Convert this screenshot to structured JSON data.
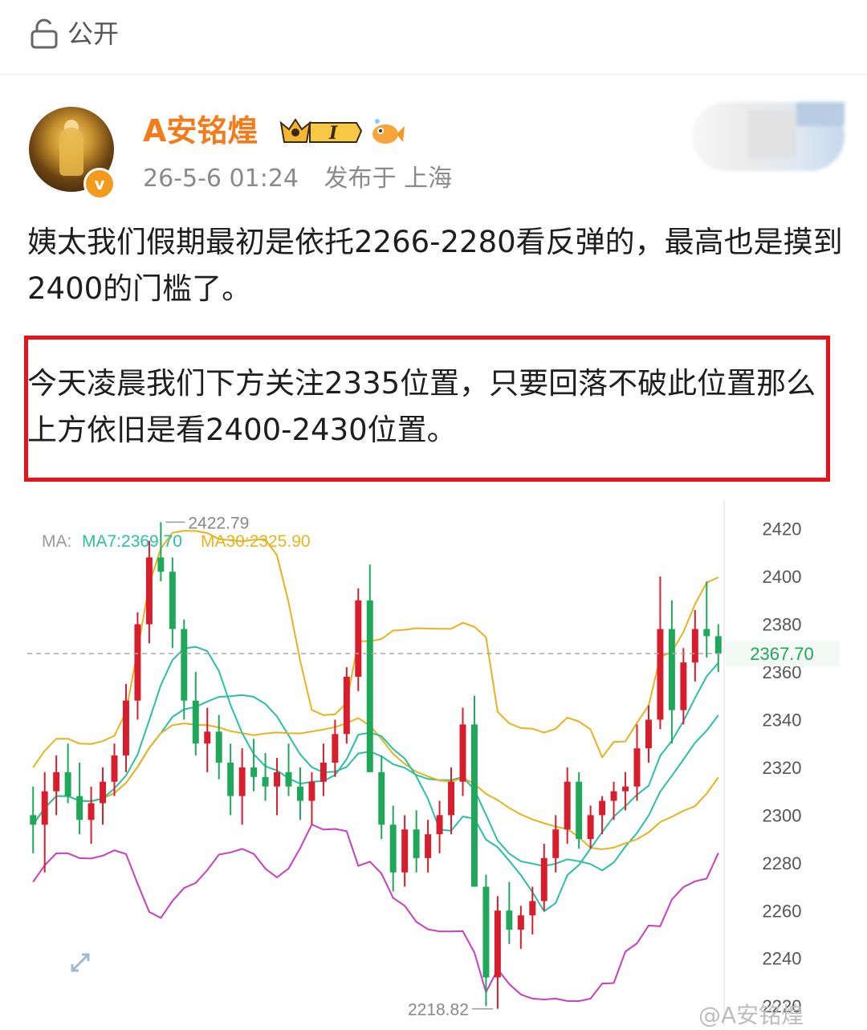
{
  "visibility": {
    "label": "公开",
    "icon": "lock-icon"
  },
  "post": {
    "author": "A安铭煌",
    "level_badge": "I",
    "date": "26-5-6 01:24",
    "location": "发布于 上海",
    "paragraph1": "姨太我们假期最初是依托2266-2280看反弹的，最高也是摸到2400的门槛了。",
    "paragraph2": "今天凌晨我们下方关注2335位置，只要回落不破此位置那么上方依旧是看2400-2430位置。",
    "watermark": "@A安铭煌"
  },
  "colors": {
    "username": "#f27b1c",
    "highlight_border": "#e8121b",
    "candle_up": "#d81e2c",
    "candle_down": "#1fa85a",
    "ma7": "#2bbfa4",
    "ma30": "#e8b21f",
    "boll_upper": "#e8b21f",
    "boll_mid": "#2bbfa4",
    "boll_lower": "#c93fbf"
  },
  "chart_data": {
    "type": "candlestick",
    "ma_label": "MA:",
    "ma7_label": "MA7:2369.70",
    "ma30_label": "MA30:2325.90",
    "high_label": "2422.79",
    "low_label": "2218.82",
    "last_price_label": "2367.70",
    "y_ticks": [
      "2420",
      "2400",
      "2380",
      "2360",
      "2340",
      "2320",
      "2300",
      "2280",
      "2260",
      "2240",
      "2220"
    ],
    "ylim": [
      2214,
      2432
    ],
    "candles": [
      [
        2300,
        2312,
        2284,
        2296
      ],
      [
        2296,
        2318,
        2276,
        2310
      ],
      [
        2310,
        2325,
        2300,
        2318
      ],
      [
        2318,
        2330,
        2305,
        2308
      ],
      [
        2308,
        2322,
        2292,
        2298
      ],
      [
        2298,
        2312,
        2288,
        2305
      ],
      [
        2305,
        2320,
        2296,
        2314
      ],
      [
        2314,
        2330,
        2308,
        2325
      ],
      [
        2325,
        2355,
        2318,
        2348
      ],
      [
        2348,
        2385,
        2340,
        2380
      ],
      [
        2380,
        2415,
        2372,
        2408
      ],
      [
        2408,
        2422.79,
        2398,
        2402
      ],
      [
        2402,
        2408,
        2370,
        2378
      ],
      [
        2378,
        2382,
        2340,
        2348
      ],
      [
        2348,
        2360,
        2325,
        2330
      ],
      [
        2330,
        2345,
        2318,
        2335
      ],
      [
        2335,
        2342,
        2315,
        2322
      ],
      [
        2322,
        2330,
        2300,
        2308
      ],
      [
        2308,
        2328,
        2296,
        2320
      ],
      [
        2320,
        2332,
        2310,
        2316
      ],
      [
        2316,
        2326,
        2306,
        2312
      ],
      [
        2312,
        2324,
        2300,
        2318
      ],
      [
        2318,
        2330,
        2308,
        2312
      ],
      [
        2312,
        2320,
        2298,
        2306
      ],
      [
        2306,
        2318,
        2296,
        2314
      ],
      [
        2314,
        2330,
        2308,
        2322
      ],
      [
        2322,
        2340,
        2316,
        2334
      ],
      [
        2334,
        2362,
        2330,
        2358
      ],
      [
        2358,
        2395,
        2352,
        2390
      ],
      [
        2390,
        2405,
        2330,
        2318
      ],
      [
        2318,
        2325,
        2290,
        2296
      ],
      [
        2296,
        2304,
        2268,
        2276
      ],
      [
        2276,
        2300,
        2270,
        2294
      ],
      [
        2294,
        2302,
        2276,
        2282
      ],
      [
        2282,
        2298,
        2276,
        2292
      ],
      [
        2292,
        2306,
        2284,
        2300
      ],
      [
        2300,
        2320,
        2292,
        2314
      ],
      [
        2314,
        2345,
        2308,
        2338
      ],
      [
        2338,
        2350,
        2280,
        2270
      ],
      [
        2270,
        2275,
        2220,
        2232
      ],
      [
        2232,
        2266,
        2218.82,
        2260
      ],
      [
        2260,
        2272,
        2246,
        2252
      ],
      [
        2252,
        2262,
        2244,
        2258
      ],
      [
        2258,
        2270,
        2250,
        2264
      ],
      [
        2264,
        2288,
        2260,
        2282
      ],
      [
        2282,
        2300,
        2276,
        2294
      ],
      [
        2294,
        2320,
        2288,
        2314
      ],
      [
        2314,
        2318,
        2286,
        2290
      ],
      [
        2290,
        2304,
        2286,
        2300
      ],
      [
        2300,
        2308,
        2292,
        2306
      ],
      [
        2306,
        2314,
        2298,
        2310
      ],
      [
        2310,
        2318,
        2302,
        2312
      ],
      [
        2312,
        2338,
        2306,
        2328
      ],
      [
        2328,
        2346,
        2322,
        2340
      ],
      [
        2340,
        2400,
        2336,
        2378
      ],
      [
        2378,
        2390,
        2330,
        2344
      ],
      [
        2344,
        2370,
        2338,
        2364
      ],
      [
        2364,
        2386,
        2356,
        2378
      ],
      [
        2378,
        2398,
        2366,
        2375
      ],
      [
        2375,
        2380,
        2360,
        2367.7
      ]
    ]
  }
}
